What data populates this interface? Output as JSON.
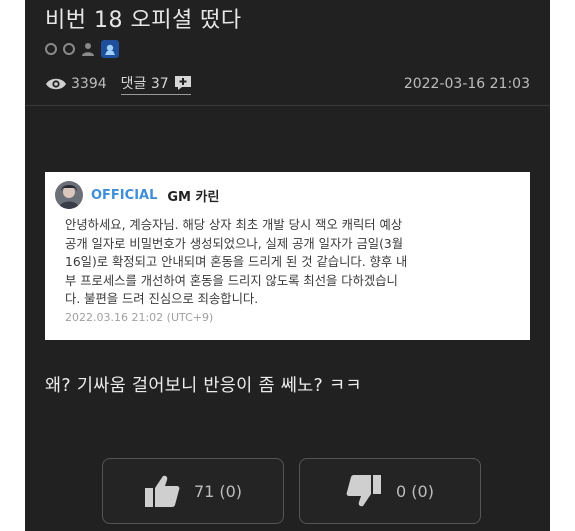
{
  "post": {
    "title": "비번 18 오피셜 떴다",
    "views": "3394",
    "comments_label": "댓글 37",
    "date": "2022-03-16 21:03"
  },
  "notice": {
    "official": "OFFICIAL",
    "author": "GM 카린",
    "body": "안녕하세요, 계승자님. 해당 상자 최초 개발 당시 잭오 캐릭터 예상\n공개 일자로 비밀번호가 생성되었으나, 실제 공개 일자가 금일(3월\n16일)로 확정되고 안내되며 혼동을 드리게 된 것 같습니다. 향후 내\n부 프로세스를 개선하여 혼동을 드리지 않도록 최선을 다하겠습니\n다. 불편을 드려 진심으로 죄송합니다.",
    "timestamp": "2022.03.16 21:02 (UTC+9)"
  },
  "comment_text": "왜? 기싸움 걸어보니 반응이 좀 쎄노? ㅋㅋ",
  "votes": {
    "like_label": "71 (0)",
    "dislike_label": "0 (0)"
  },
  "colors": {
    "background": "#212121",
    "official": "#3f8ed8",
    "text": "#e6e6e6"
  },
  "icons": [
    "eye-icon",
    "comment-plus-icon",
    "thumbs-up-icon",
    "thumbs-down-icon",
    "person-icon",
    "level-badge-icon"
  ]
}
